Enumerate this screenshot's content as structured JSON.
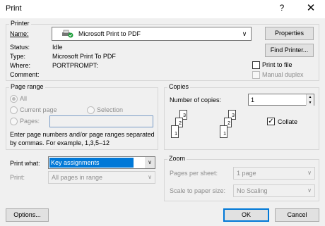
{
  "window": {
    "title": "Print",
    "help_glyph": "?",
    "close_glyph": "✕"
  },
  "printer": {
    "legend": "Printer",
    "name_label": "Name:",
    "name_value": "Microsoft Print to PDF",
    "status_label": "Status:",
    "status_value": "Idle",
    "type_label": "Type:",
    "type_value": "Microsoft Print To PDF",
    "where_label": "Where:",
    "where_value": "PORTPROMPT:",
    "comment_label": "Comment:",
    "comment_value": "",
    "properties_button": "Properties",
    "find_printer_button": "Find Printer...",
    "print_to_file_label": "Print to file",
    "print_to_file_checked": false,
    "manual_duplex_label": "Manual duplex",
    "manual_duplex_checked": false
  },
  "page_range": {
    "legend": "Page range",
    "all_label": "All",
    "current_page_label": "Current page",
    "selection_label": "Selection",
    "pages_label": "Pages:",
    "pages_value": "",
    "hint_line1": "Enter page numbers and/or page ranges separated",
    "hint_line2": "by commas.  For example, 1,3,5–12"
  },
  "copies": {
    "legend": "Copies",
    "number_label": "Number of copies:",
    "number_value": "1",
    "collate_label": "Collate",
    "collate_checked": true,
    "collate_icon_pages": [
      "3",
      "2",
      "1"
    ]
  },
  "print_what": {
    "label": "Print what:",
    "value": "Key assignments",
    "print_label": "Print:",
    "print_value": "All pages in range"
  },
  "zoom": {
    "legend": "Zoom",
    "pages_per_sheet_label": "Pages per sheet:",
    "pages_per_sheet_value": "1 page",
    "scale_label": "Scale to paper size:",
    "scale_value": "No Scaling"
  },
  "footer": {
    "options_button": "Options...",
    "ok_button": "OK",
    "cancel_button": "Cancel"
  },
  "colors": {
    "accent": "#0078d7",
    "selection_bg": "#0078d7"
  },
  "icons": {
    "dropdown_arrow": "∨",
    "spin_up": "▲",
    "spin_down": "▼",
    "check": "✓",
    "printer": "printer-icon"
  }
}
